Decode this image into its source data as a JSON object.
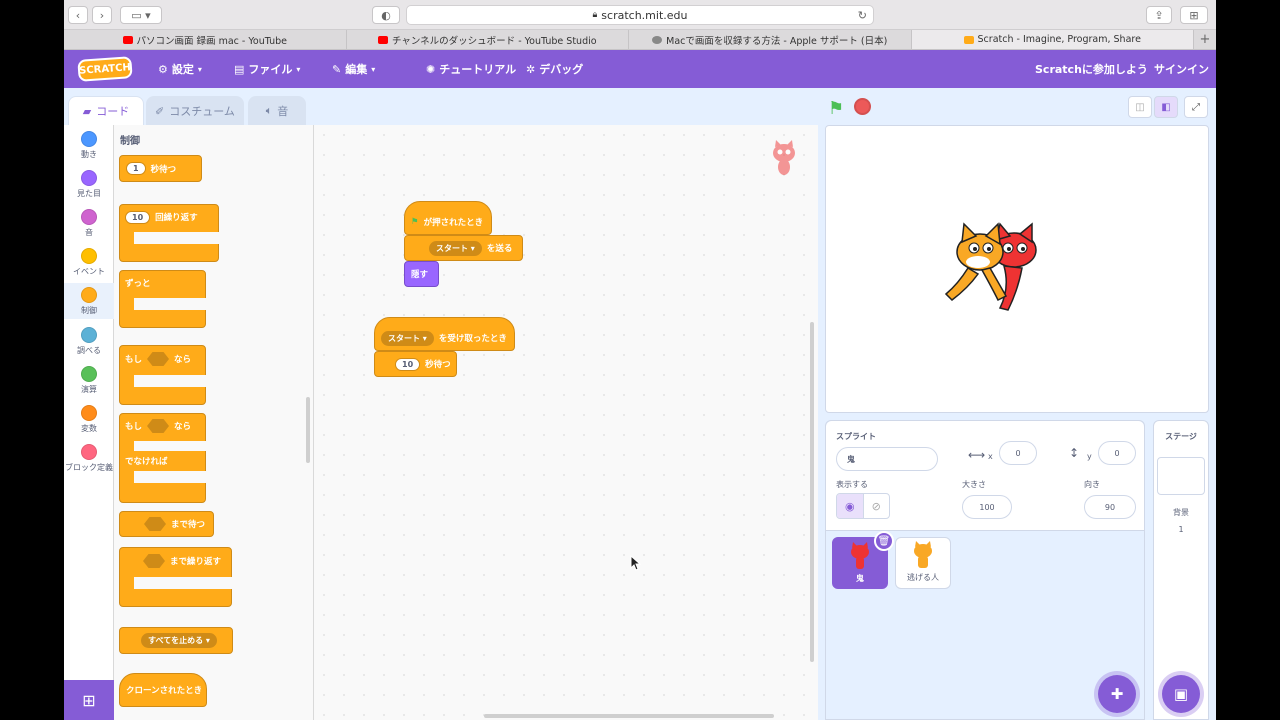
{
  "browser": {
    "url": "scratch.mit.edu",
    "tabs": [
      {
        "label": "パソコン画面 録画 mac - YouTube",
        "icon": "youtube-icon"
      },
      {
        "label": "チャンネルのダッシュボード - YouTube Studio",
        "icon": "youtube-icon"
      },
      {
        "label": "Macで画面を収録する方法 - Apple サポート (日本)",
        "icon": "apple-icon"
      },
      {
        "label": "Scratch - Imagine, Program, Share",
        "icon": "scratch-icon"
      }
    ],
    "new_tab": "+"
  },
  "menu": {
    "logo": "SCRATCH",
    "settings": "設定",
    "file": "ファイル",
    "edit": "編集",
    "tutorial": "チュートリアル",
    "debug": "デバッグ",
    "join": "Scratchに参加しよう",
    "signin": "サインイン"
  },
  "editor_tabs": {
    "code": "コード",
    "costume": "コスチューム",
    "sound": "音"
  },
  "categories": [
    {
      "label": "動き",
      "color": "#4c97ff"
    },
    {
      "label": "見た目",
      "color": "#9966ff"
    },
    {
      "label": "音",
      "color": "#cf63cf"
    },
    {
      "label": "イベント",
      "color": "#ffbf00"
    },
    {
      "label": "制御",
      "color": "#ffab19"
    },
    {
      "label": "調べる",
      "color": "#5cb1d6"
    },
    {
      "label": "演算",
      "color": "#59c059"
    },
    {
      "label": "変数",
      "color": "#ff8c1a"
    },
    {
      "label": "ブロック定義",
      "color": "#ff6680"
    }
  ],
  "palette": {
    "title": "制御",
    "wait_num": "1",
    "wait_label": "秒待つ",
    "repeat_num": "10",
    "repeat_label": "回繰り返す",
    "forever": "ずっと",
    "if": "もし",
    "then": "なら",
    "else": "でなければ",
    "wait_until": "まで待つ",
    "repeat_until": "まで繰り返す",
    "stop_all": "すべてを止める",
    "clone_start": "クローンされたとき"
  },
  "script": {
    "flag_clicked": "が押されたとき",
    "broadcast_msg": "スタート",
    "broadcast_label": "を送る",
    "hide": "隠す",
    "receive_msg": "スタート",
    "receive_label": "を受け取ったとき",
    "wait_num": "10",
    "wait_label": "秒待つ"
  },
  "sprite_info": {
    "sprite_label": "スプライト",
    "sprite_name": "鬼",
    "x_label": "x",
    "x": "0",
    "y_label": "y",
    "y": "0",
    "show_label": "表示する",
    "size_label": "大きさ",
    "size": "100",
    "direction_label": "向き",
    "direction": "90"
  },
  "sprites": [
    {
      "name": "鬼",
      "selected": true
    },
    {
      "name": "逃げる人",
      "selected": false
    }
  ],
  "stage_panel": {
    "title": "ステージ",
    "backdrop_label": "背景",
    "backdrop_count": "1"
  },
  "zoom_reset": "="
}
